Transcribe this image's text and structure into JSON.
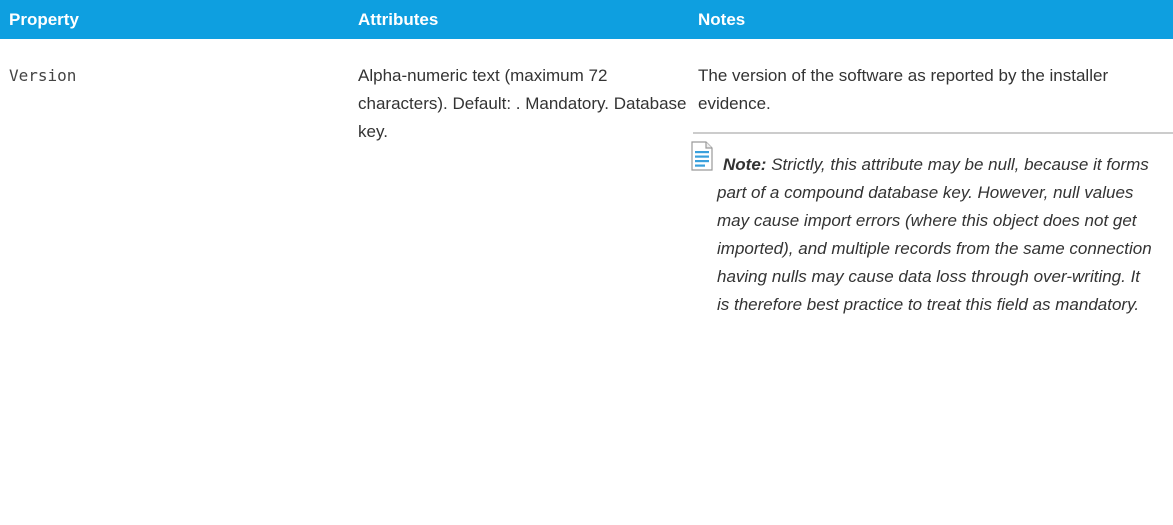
{
  "table": {
    "headers": [
      "Property",
      "Attributes",
      "Notes"
    ],
    "row": {
      "property": "Version",
      "attributes": "Alpha-numeric text (maximum 72 characters). Default: . Mandatory. Database key.",
      "notes": "The version of the software as reported by the installer evidence.",
      "note_label": "Note:",
      "note_body": "Strictly, this attribute may be null, because it forms part of a compound database key. However, null values may cause import errors (where this object does not get imported), and multiple records from the same connection having nulls may cause data loss through over-writing. It is therefore best practice to treat this field as mandatory."
    }
  },
  "icons": {
    "note": "note-document-icon"
  },
  "colors": {
    "header_background": "#0e9fe0",
    "header_text": "#ffffff",
    "body_text": "#333333",
    "divider": "#cccccc"
  }
}
